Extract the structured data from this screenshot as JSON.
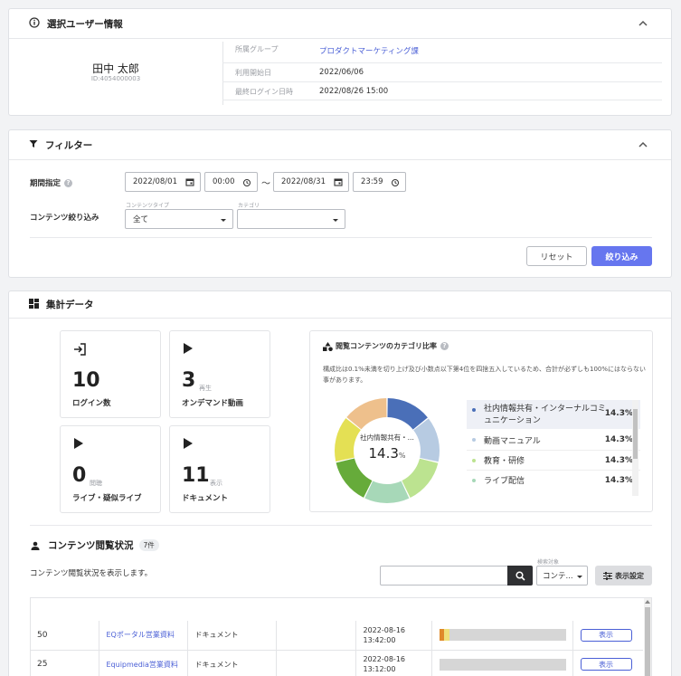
{
  "user_card": {
    "title": "選択ユーザー情報",
    "name": "田中 太郎",
    "user_id": "ID:4054000003",
    "rows": [
      {
        "label": "所属グループ",
        "value": "プロダクトマーケティング課"
      },
      {
        "label": "利用開始日",
        "value": "2022/06/06"
      },
      {
        "label": "最終ログイン日時",
        "value": "2022/08/26 15:00"
      }
    ]
  },
  "filter": {
    "title": "フィルター",
    "period_label": "期間指定",
    "start_date": "2022/08/01",
    "start_time": "00:00",
    "tilde": "〜",
    "end_date": "2022/08/31",
    "end_time": "23:59",
    "content_label": "コンテンツ絞り込み",
    "type_caption": "コンテンツタイプ",
    "type_value": "全て",
    "category_caption": "カテゴリ",
    "category_value": "",
    "reset_label": "リセット",
    "apply_label": "絞り込み"
  },
  "summary": {
    "title": "集計データ",
    "stats": [
      {
        "value": "10",
        "unit": "",
        "name": "ログイン数",
        "icon": "login-icon"
      },
      {
        "value": "3",
        "unit": "再生",
        "name": "オンデマンド動画",
        "icon": "play-icon"
      },
      {
        "value": "0",
        "unit": "閲聴",
        "name": "ライブ・疑似ライブ",
        "icon": "play-icon"
      },
      {
        "value": "11",
        "unit": "表示",
        "name": "ドキュメント",
        "icon": "play-icon"
      }
    ],
    "ratio": {
      "title": "閲覧コンテンツのカテゴリ比率",
      "note": "構成比は0.1%未満を切り上げ及び小数点以下第4位を四捨五入しているため、合計が必ずしも100%にはならない事があります。",
      "center_label": "社内情報共有・...",
      "center_value": "14.3",
      "center_unit": "%"
    }
  },
  "chart_data": {
    "type": "pie",
    "title": "閲覧コンテンツのカテゴリ比率",
    "categories": [
      "社内情報共有・インターナルコミュニケーション",
      "動画マニュアル",
      "教育・研修",
      "ライブ配信",
      "",
      "",
      ""
    ],
    "values": [
      14.3,
      14.3,
      14.3,
      14.3,
      14.3,
      14.3,
      14.2
    ],
    "colors": [
      "#4a6fb8",
      "#b7cbe2",
      "#bce390",
      "#a7d8b8",
      "#66ab3a",
      "#e4e054",
      "#eec08c"
    ],
    "value_labels": [
      "14.3%",
      "14.3%",
      "14.3%",
      "14.3%"
    ]
  },
  "content_status": {
    "title": "コンテンツ閲覧状況",
    "count_badge": "7件",
    "description": "コンテンツ閲覧状況を表示します。",
    "search_placeholder": "",
    "search_target_caption": "検索対象",
    "search_target_value": "コンテ...",
    "display_settings_label": "表示設定",
    "rows": [
      {
        "count": "50",
        "title": "EQポータル営業資料",
        "type": "ドキュメント",
        "datetime": "2022-08-16 13:42:00",
        "progress": 0.08,
        "action": "表示"
      },
      {
        "count": "25",
        "title": "Equipmedia営業資料",
        "type": "ドキュメント",
        "datetime": "2022-08-16 13:12:00",
        "progress": 0,
        "action": "表示"
      }
    ]
  },
  "colors": {
    "accent": "#6676ef",
    "link": "#4a5fd6",
    "search_btn": "#2f3033"
  }
}
